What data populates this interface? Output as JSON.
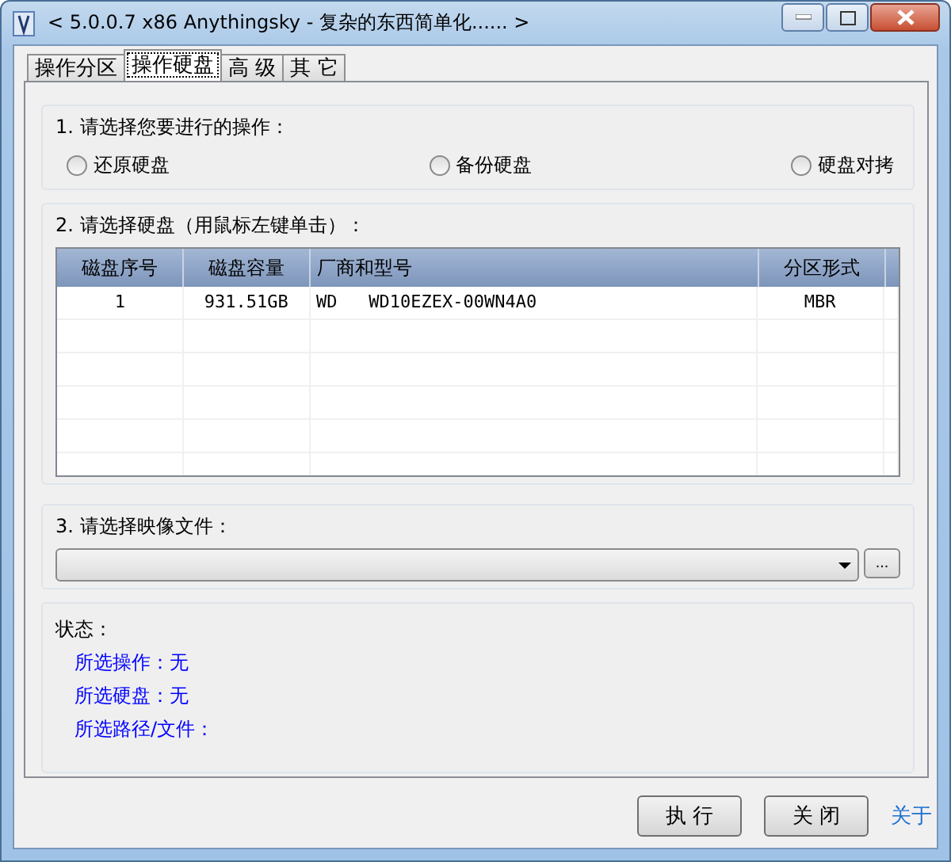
{
  "window": {
    "title": "< 5.0.0.7 x86 Anythingsky - 复杂的东西简单化...... >"
  },
  "tabs": [
    {
      "label": "操作分区",
      "selected": false
    },
    {
      "label": "操作硬盘",
      "selected": true
    },
    {
      "label": "高 级",
      "selected": false
    },
    {
      "label": "其 它",
      "selected": false
    }
  ],
  "operation": {
    "label": "1. 请选择您要进行的操作：",
    "options": [
      {
        "label": "还原硬盘",
        "selected": false
      },
      {
        "label": "备份硬盘",
        "selected": false
      },
      {
        "label": "硬盘对拷",
        "selected": false
      }
    ]
  },
  "disk": {
    "label": "2. 请选择硬盘（用鼠标左键单击）：",
    "columns": [
      "磁盘序号",
      "磁盘容量",
      "厂商和型号",
      "分区形式"
    ],
    "rows": [
      [
        "1",
        "931.51GB",
        "WD   WD10EZEX-00WN4A0",
        "MBR"
      ]
    ]
  },
  "image": {
    "label": "3. 请选择映像文件：",
    "browse": "..."
  },
  "status": {
    "label": "状态：",
    "lines": [
      "所选操作：无",
      "所选硬盘：无",
      "所选路径/文件："
    ]
  },
  "buttons": [
    "执 行",
    "关 闭"
  ],
  "about_link": "关于"
}
